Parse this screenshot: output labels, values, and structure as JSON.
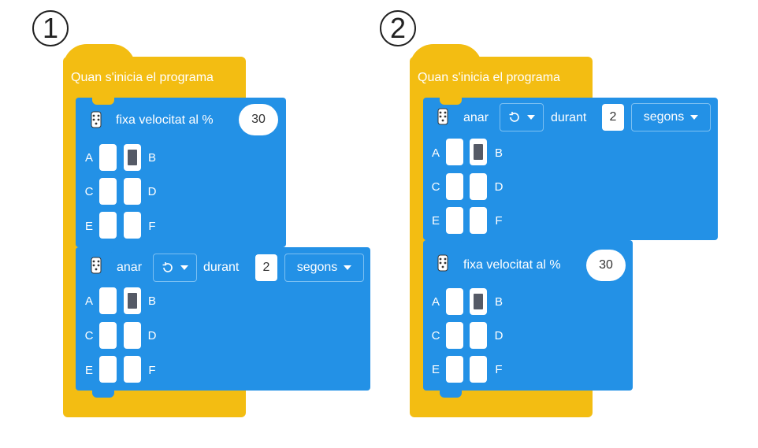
{
  "panels": [
    {
      "number": "1",
      "hat_label": "Quan s'inicia el programa",
      "blocks": [
        {
          "type": "speed",
          "label": "fixa velocitat al %",
          "value": "30"
        },
        {
          "type": "run",
          "label": "anar",
          "direction_icon": "counterclockwise-icon",
          "durant": "durant",
          "value": "2",
          "unit": "segons"
        }
      ]
    },
    {
      "number": "2",
      "hat_label": "Quan s'inicia el programa",
      "blocks": [
        {
          "type": "run",
          "label": "anar",
          "direction_icon": "counterclockwise-icon",
          "durant": "durant",
          "value": "2",
          "unit": "segons"
        },
        {
          "type": "speed",
          "label": "fixa velocitat al %",
          "value": "30"
        }
      ]
    }
  ],
  "ports": {
    "A": "A",
    "B": "B",
    "C": "C",
    "D": "D",
    "E": "E",
    "F": "F",
    "selected": "B"
  },
  "colors": {
    "hat": "#f3bd12",
    "block": "#2391e6",
    "selected_port": "#555a66"
  }
}
